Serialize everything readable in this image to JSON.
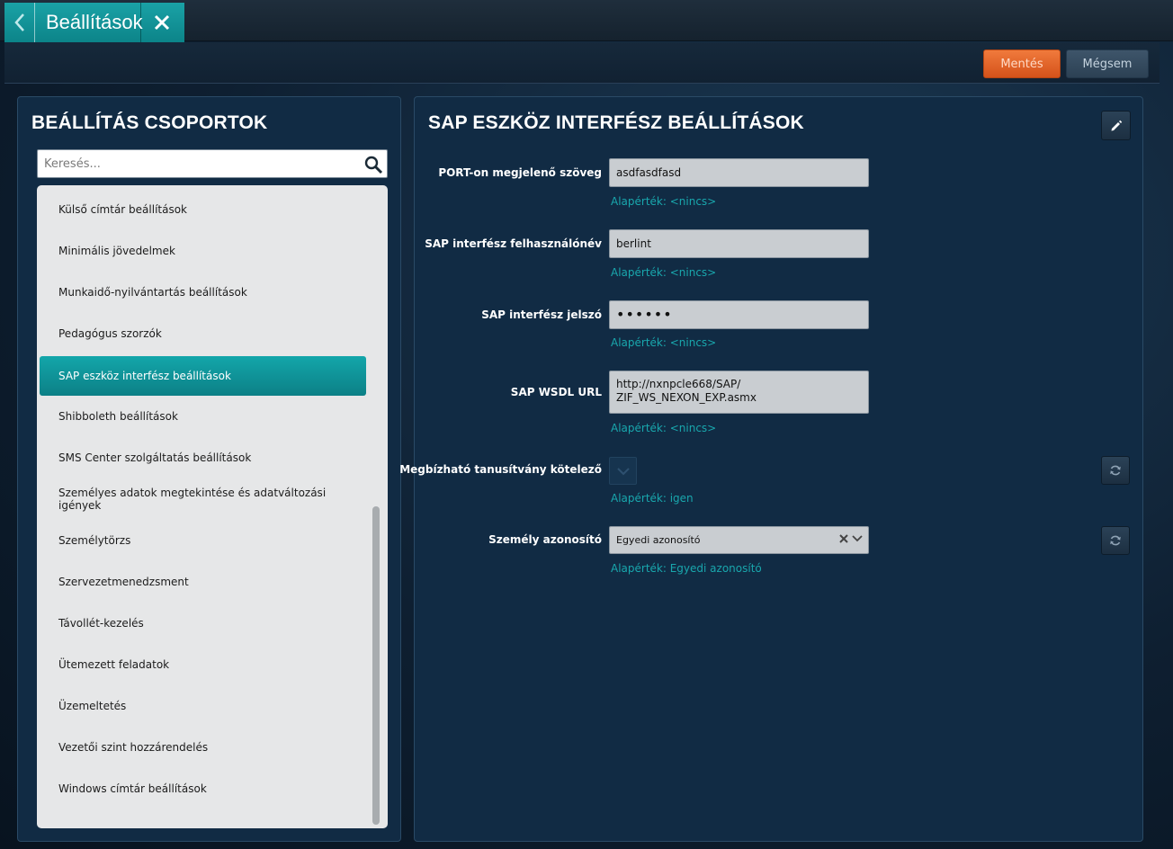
{
  "header": {
    "title": "Beállítások"
  },
  "toolbar": {
    "save_label": "Mentés",
    "cancel_label": "Mégsem"
  },
  "left_panel": {
    "title": "BEÁLLÍTÁS CSOPORTOK",
    "search": {
      "placeholder": "Keresés...",
      "value": ""
    },
    "items": [
      "Külső címtár beállítások",
      "Minimális jövedelmek",
      "Munkaidő-nyilvántartás beállítások",
      "Pedagógus szorzók",
      "SAP eszköz interfész beállítások",
      "Shibboleth beállítások",
      "SMS Center szolgáltatás beállítások",
      "Személyes adatok megtekintése és adatváltozási igények",
      "Személytörzs",
      "Szervezetmenedzsment",
      "Távollét-kezelés",
      "Ütemezett feladatok",
      "Üzemeltetés",
      "Vezetői szint hozzárendelés",
      "Windows címtár beállítások"
    ],
    "selected_item": "SAP eszköz interfész beállítások"
  },
  "right_panel": {
    "title": "SAP ESZKÖZ INTERFÉSZ BEÁLLÍTÁSOK",
    "fields": {
      "port_text": {
        "label": "PORT-on megjelenő szöveg",
        "value": "asdfasdfasd",
        "default": "Alapérték: <nincs>"
      },
      "username": {
        "label": "SAP interfész felhasználónév",
        "value": "berlint",
        "default": "Alapérték: <nincs>"
      },
      "password": {
        "label": "SAP interfész jelszó",
        "value": "••••••",
        "default": "Alapérték: <nincs>"
      },
      "wsdl_url": {
        "label": "SAP WSDL URL",
        "value": "http://nxnpcle668/SAP/\nZIF_WS_NEXON_EXP.asmx",
        "default": "Alapérték: <nincs>"
      },
      "trusted_cert": {
        "label": "Megbízható tanusítvány kötelező",
        "checked": true,
        "default": "Alapérték: igen"
      },
      "person_id": {
        "label": "Személy azonosító",
        "value": "Egyedi azonosító",
        "default": "Alapérték: Egyedi azonosító"
      }
    }
  },
  "colors": {
    "accent_teal": "#0f9aa0",
    "save_orange": "#e5612a",
    "panel_bg": "#112b44"
  },
  "icons": [
    "chevron-left-icon",
    "close-icon",
    "search-icon",
    "pencil-icon",
    "refresh-icon",
    "checkmark-icon",
    "clear-icon",
    "chevron-down-icon"
  ]
}
